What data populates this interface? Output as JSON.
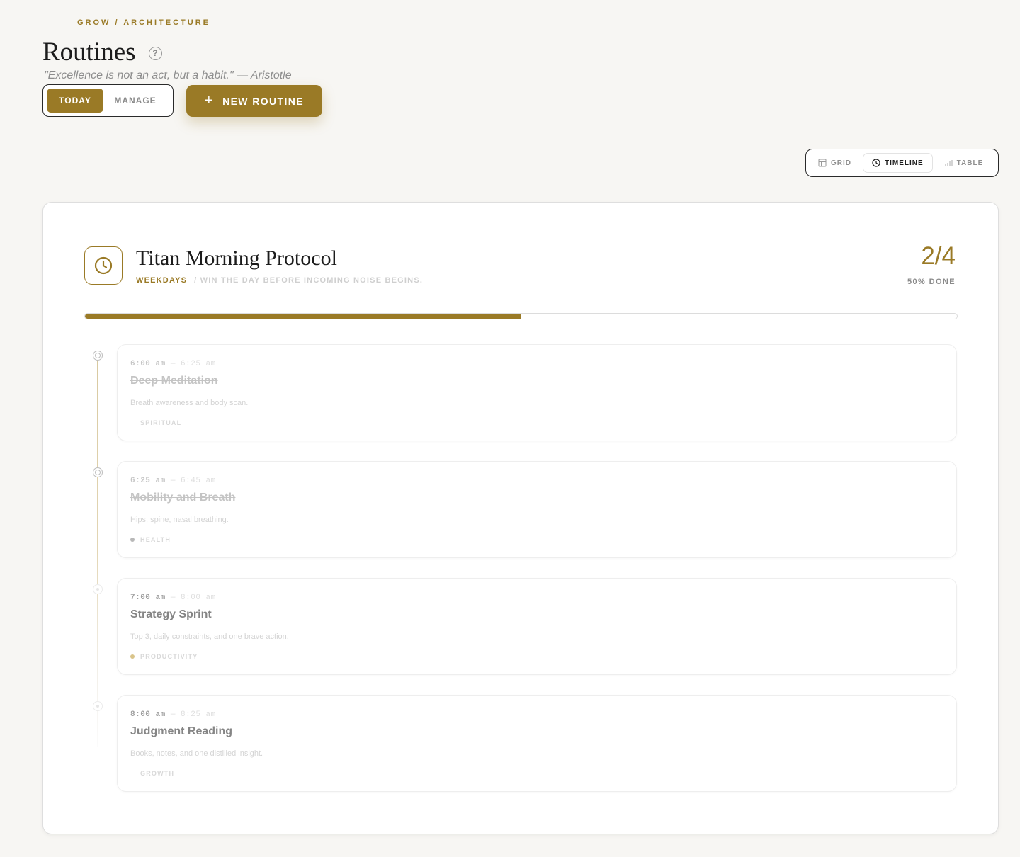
{
  "breadcrumb": "GROW / ARCHITECTURE",
  "page": {
    "title": "Routines",
    "help_icon": "question-circle-icon",
    "quote": "\"Excellence is not an act, but a habit.\" — Aristotle"
  },
  "mode_toggle": {
    "today": "TODAY",
    "manage": "MANAGE",
    "active": "today"
  },
  "new_routine": {
    "label": "NEW ROUTINE",
    "icon": "+"
  },
  "view_switch": {
    "grid": "GRID",
    "timeline": "TIMELINE",
    "table": "TABLE",
    "active": "timeline"
  },
  "routine": {
    "icon": "clock-icon",
    "name": "Titan Morning Protocol",
    "days": "WEEKDAYS",
    "description": "/ WIN THE DAY BEFORE INCOMING NOISE BEGINS.",
    "ratio": "2/4",
    "done_label": "50% DONE",
    "progress_fraction": 0.5
  },
  "items": [
    {
      "start": "6:00 am",
      "sep": "—",
      "end": "6:25 am",
      "name": "Deep Meditation",
      "note": "Breath awareness and body scan.",
      "tag": "SPIRITUAL",
      "tag_color": "",
      "done": true
    },
    {
      "start": "6:25 am",
      "sep": "—",
      "end": "6:45 am",
      "name": "Mobility and Breath",
      "note": "Hips, spine, nasal breathing.",
      "tag": "HEALTH",
      "tag_color": "#b8b8b8",
      "done": true
    },
    {
      "start": "7:00 am",
      "sep": "—",
      "end": "8:00 am",
      "name": "Strategy Sprint",
      "note": "Top 3, daily constraints, and one brave action.",
      "tag": "PRODUCTIVITY",
      "tag_color": "#d9c48a",
      "done": false
    },
    {
      "start": "8:00 am",
      "sep": "—",
      "end": "8:25 am",
      "name": "Judgment Reading",
      "note": "Books, notes, and one distilled insight.",
      "tag": "GROWTH",
      "tag_color": "",
      "done": false
    }
  ],
  "colors": {
    "accent": "#9a7a26",
    "background": "#f7f6f3"
  }
}
